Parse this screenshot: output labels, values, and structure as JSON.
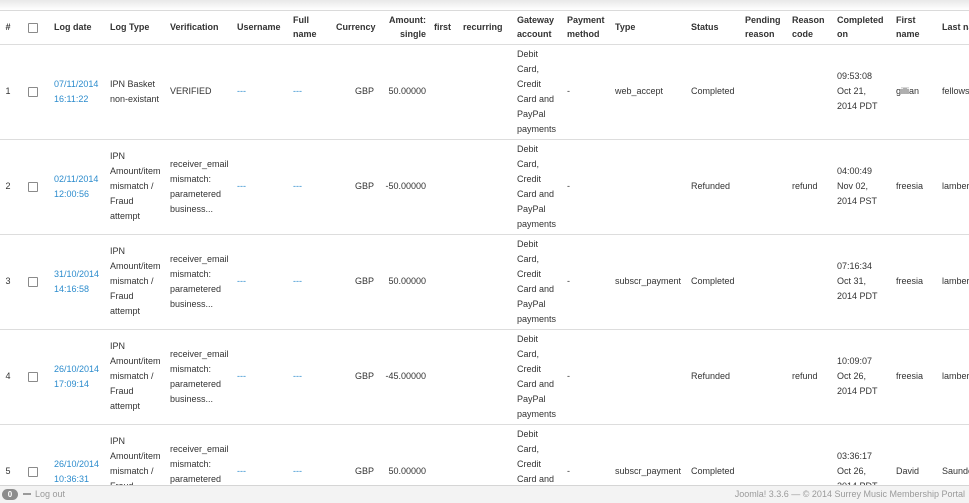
{
  "columns": [
    {
      "key": "num",
      "label": "#"
    },
    {
      "key": "select",
      "label": ""
    },
    {
      "key": "log_date",
      "label": "Log date"
    },
    {
      "key": "log_type",
      "label": "Log Type"
    },
    {
      "key": "verification",
      "label": "Verification"
    },
    {
      "key": "username",
      "label": "Username"
    },
    {
      "key": "full_name",
      "label": "Full name"
    },
    {
      "key": "currency",
      "label": "Currency"
    },
    {
      "key": "amount_single",
      "label": "Amount: single"
    },
    {
      "key": "first",
      "label": "first"
    },
    {
      "key": "recurring",
      "label": "recurring"
    },
    {
      "key": "gateway_account",
      "label": "Gateway account"
    },
    {
      "key": "payment_method",
      "label": "Payment method"
    },
    {
      "key": "type",
      "label": "Type"
    },
    {
      "key": "status",
      "label": "Status"
    },
    {
      "key": "pending_reason",
      "label": "Pending reason"
    },
    {
      "key": "reason_code",
      "label": "Reason code"
    },
    {
      "key": "completed_on",
      "label": "Completed on"
    },
    {
      "key": "first_name",
      "label": "First name"
    },
    {
      "key": "last_name",
      "label": "Last name"
    }
  ],
  "rows": [
    {
      "num": "1",
      "log_date": "07/11/2014 16:11:22",
      "log_type": "IPN Basket non-existant",
      "verification": "VERIFIED",
      "username": "---",
      "full_name": "---",
      "currency": "GBP",
      "amount_single": "50.00000",
      "first": "",
      "recurring": "",
      "gateway_account": "Debit Card, Credit Card and PayPal payments",
      "payment_method": "-",
      "type": "web_accept",
      "status": "Completed",
      "pending_reason": "",
      "reason_code": "",
      "completed_on": "09:53:08 Oct 21, 2014 PDT",
      "first_name": "gillian",
      "last_name": "fellows"
    },
    {
      "num": "2",
      "log_date": "02/11/2014 12:00:56",
      "log_type": "IPN Amount/item mismatch / Fraud attempt",
      "verification": "receiver_email mismatch: parametered business...",
      "username": "---",
      "full_name": "---",
      "currency": "GBP",
      "amount_single": "-50.00000",
      "first": "",
      "recurring": "",
      "gateway_account": "Debit Card, Credit Card and PayPal payments",
      "payment_method": "-",
      "type": "",
      "status": "Refunded",
      "pending_reason": "",
      "reason_code": "refund",
      "completed_on": "04:00:49 Nov 02, 2014 PST",
      "first_name": "freesia",
      "last_name": "lambert"
    },
    {
      "num": "3",
      "log_date": "31/10/2014 14:16:58",
      "log_type": "IPN Amount/item mismatch / Fraud attempt",
      "verification": "receiver_email mismatch: parametered business...",
      "username": "---",
      "full_name": "---",
      "currency": "GBP",
      "amount_single": "50.00000",
      "first": "",
      "recurring": "",
      "gateway_account": "Debit Card, Credit Card and PayPal payments",
      "payment_method": "-",
      "type": "subscr_payment",
      "status": "Completed",
      "pending_reason": "",
      "reason_code": "",
      "completed_on": "07:16:34 Oct 31, 2014 PDT",
      "first_name": "freesia",
      "last_name": "lambert"
    },
    {
      "num": "4",
      "log_date": "26/10/2014 17:09:14",
      "log_type": "IPN Amount/item mismatch / Fraud attempt",
      "verification": "receiver_email mismatch: parametered business...",
      "username": "---",
      "full_name": "---",
      "currency": "GBP",
      "amount_single": "-45.00000",
      "first": "",
      "recurring": "",
      "gateway_account": "Debit Card, Credit Card and PayPal payments",
      "payment_method": "-",
      "type": "",
      "status": "Refunded",
      "pending_reason": "",
      "reason_code": "refund",
      "completed_on": "10:09:07 Oct 26, 2014 PDT",
      "first_name": "freesia",
      "last_name": "lambert"
    },
    {
      "num": "5",
      "log_date": "26/10/2014 10:36:31",
      "log_type": "IPN Amount/item mismatch / Fraud attempt",
      "verification": "receiver_email mismatch: parametered business...",
      "username": "---",
      "full_name": "---",
      "currency": "GBP",
      "amount_single": "50.00000",
      "first": "",
      "recurring": "",
      "gateway_account": "Debit Card, Credit Card and PayPal payments",
      "payment_method": "-",
      "type": "subscr_payment",
      "status": "Completed",
      "pending_reason": "",
      "reason_code": "",
      "completed_on": "03:36:17 Oct 26, 2014 PDT",
      "first_name": "David",
      "last_name": "Saunders"
    }
  ],
  "footer": {
    "badge_count": "0",
    "logout_label": "Log out",
    "credits": "Joomla! 3.3.6 — © 2014 Surrey Music Membership Portal"
  }
}
